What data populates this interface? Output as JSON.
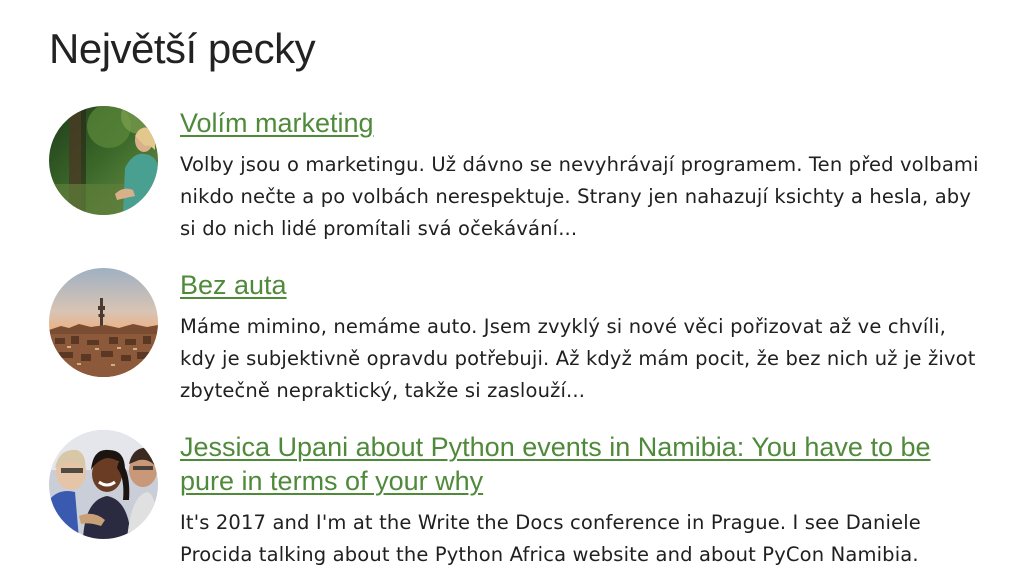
{
  "section": {
    "title": "Největší pecky"
  },
  "articles": [
    {
      "title": "Volím marketing",
      "excerpt": "Volby jsou o marketingu. Už dávno se nevyhrávají programem. Ten před volbami nikdo nečte a po volbách nerespektuje. Strany jen nahazují ksichty a hesla, aby si do nich lidé promítali svá očekávání...",
      "thumbnail": "portrait-woman-in-park"
    },
    {
      "title": "Bez auta",
      "excerpt": "Máme mimino, nemáme auto. Jsem zvyklý si nové věci pořizovat až ve chvíli, kdy je subjektivně opravdu potřebuji. Až když mám pocit, že bez nich už je život zbytečně nepraktický, takže si zaslouží...",
      "thumbnail": "city-skyline-sunset"
    },
    {
      "title": "Jessica Upani about Python events in Namibia: You have to be pure in terms of your why",
      "excerpt": "It's 2017 and I'm at the Write the Docs conference in Prague. I see Daniele Procida talking about the Python Africa website and about PyCon Namibia.",
      "thumbnail": "group-of-women-smiling"
    }
  ],
  "colors": {
    "link": "#4f8a3a",
    "heading": "#222222",
    "text": "#202020"
  }
}
